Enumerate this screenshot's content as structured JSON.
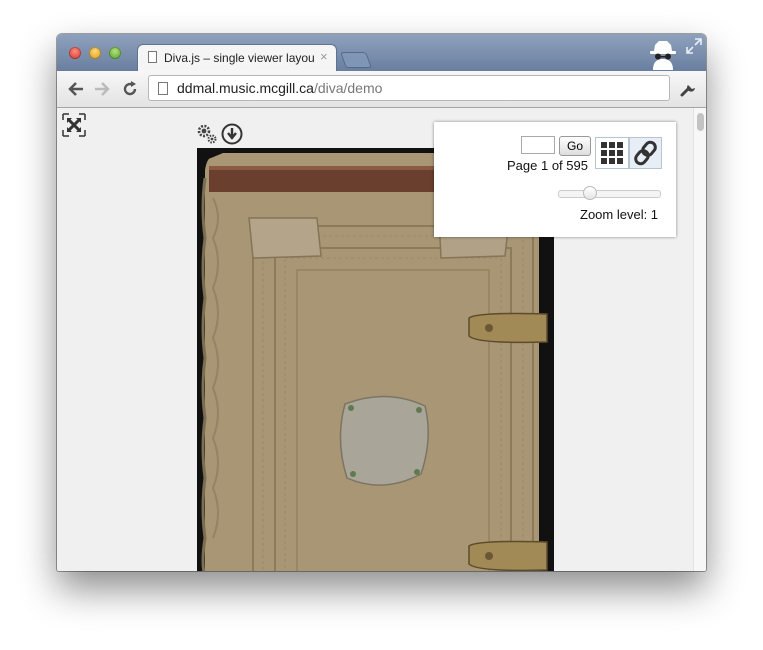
{
  "browser": {
    "tab_title": "Diva.js – single viewer layout",
    "url_host": "ddmal.music.mcgill.ca",
    "url_path": "/diva/demo"
  },
  "viewer": {
    "goto_placeholder": "",
    "go_label": "Go",
    "page_text": "Page 1 of 595",
    "zoom_text": "Zoom level: 1",
    "zoom_slider_fraction": 0.3
  },
  "colors": {
    "titlebar": "#7489aa",
    "viewer_background": "#f0f0f0",
    "leather": "#a89675"
  }
}
